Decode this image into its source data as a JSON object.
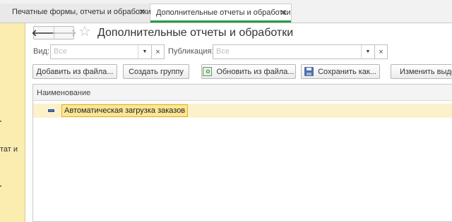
{
  "tabs": [
    {
      "label": "Печатные формы, отчеты и обработки",
      "close": "✕"
    },
    {
      "label": "Дополнительные отчеты и обработки",
      "close": "✕"
    }
  ],
  "sidebar": {
    "text": "тат и"
  },
  "nav": {
    "back": "🡐",
    "forward": "🡒"
  },
  "favorite_icon": "☆",
  "page_title": "Дополнительные отчеты и обработки",
  "filters": {
    "vid": {
      "label": "Вид:",
      "placeholder": "Все"
    },
    "publikaciya": {
      "label": "Публикация:",
      "placeholder": "Все"
    },
    "dropdown_glyph": "▼",
    "clear_glyph": "×"
  },
  "toolbar": {
    "add_from_file": "Добавить из файла...",
    "create_group": "Создать группу",
    "update_from_file": "Обновить из файла...",
    "save_as": "Сохранить как...",
    "change_selected": "Изменить выделенные"
  },
  "table": {
    "columns": [
      "Наименование"
    ],
    "rows": [
      {
        "name": "Автоматическая загрузка заказов"
      }
    ]
  },
  "colors": {
    "accent_green": "#2a9c45",
    "sidebar_yellow": "#fbedb0",
    "row_highlight": "#fbf2cc",
    "cell_border": "#e2b418"
  }
}
